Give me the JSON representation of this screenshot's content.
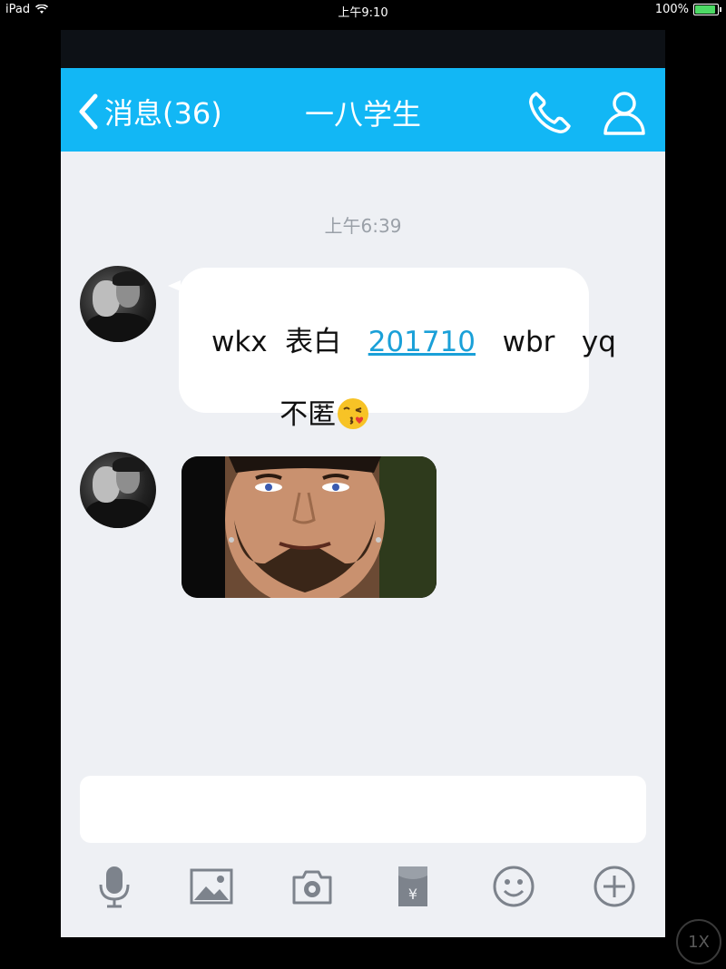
{
  "status_bar": {
    "device": "iPad",
    "time": "上午9:10",
    "battery": "100%"
  },
  "nav": {
    "back_label": "消息(36)",
    "title": "一八学生"
  },
  "chat": {
    "timestamp": "上午6:39",
    "message1": {
      "line1_prefix": "表白",
      "line1_link": "201710",
      "line1_suffix": "wbr   yq",
      "line2": "wkx",
      "line3": "不匿"
    }
  },
  "toolbar": {
    "icons": [
      "microphone-icon",
      "image-icon",
      "camera-icon",
      "red-packet-icon",
      "emoji-icon",
      "plus-icon"
    ]
  },
  "speed_button": {
    "label": "1X"
  },
  "colors": {
    "nav_bg": "#12b7f5",
    "chat_bg": "#eef0f4",
    "link": "#1aa0d8",
    "icon_gray": "#7d838c"
  }
}
